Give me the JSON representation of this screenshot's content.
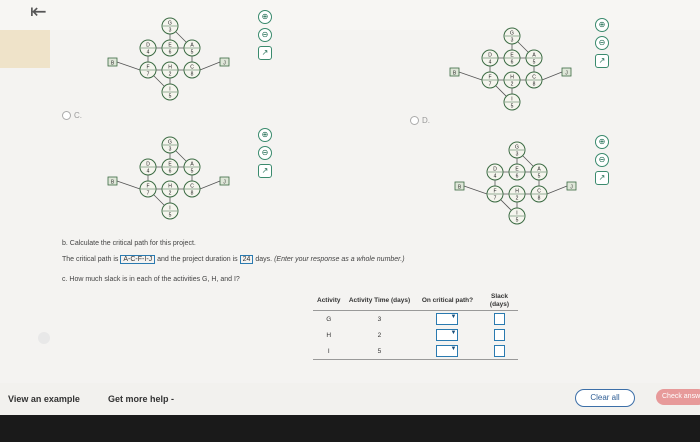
{
  "nav": {
    "back_label": "⇤"
  },
  "options": {
    "c_label": "C.",
    "d_label": "D."
  },
  "network": {
    "start_label": "B",
    "end_label": "J",
    "node_labels": [
      "G",
      "D",
      "E",
      "A",
      "F",
      "H",
      "C",
      "I"
    ],
    "node_durations": [
      "3",
      "4",
      "6",
      "5",
      "7",
      "2",
      "8",
      "5"
    ]
  },
  "zoom": {
    "in_icon": "⊕",
    "out_icon": "⊖",
    "popout_icon": "↗"
  },
  "question_b": {
    "prefix": "b. Calculate the critical path for this project.",
    "path_lead": "The critical path is",
    "path_value": "A-C-F-I-J",
    "mid": "and the project duration is",
    "duration": "24",
    "unit": "days.",
    "instruction": "(Enter your response as a whole number.)"
  },
  "question_c": {
    "text": "c. How much slack is in each of the activities G, H, and I?"
  },
  "table": {
    "headers": {
      "activity": "Activity",
      "time": "Activity Time (days)",
      "critical": "On critical path?",
      "slack": "Slack (days)"
    },
    "rows": [
      {
        "activity": "G",
        "time": "3"
      },
      {
        "activity": "H",
        "time": "2"
      },
      {
        "activity": "I",
        "time": "5"
      }
    ]
  },
  "footer": {
    "example": "View an example",
    "help": "Get more help -",
    "clear": "Clear all",
    "check": "Check answer"
  },
  "colors": {
    "node_stroke": "#3a6a42",
    "node_fill": "#f5f5ee",
    "accent": "#2a7ab0"
  }
}
